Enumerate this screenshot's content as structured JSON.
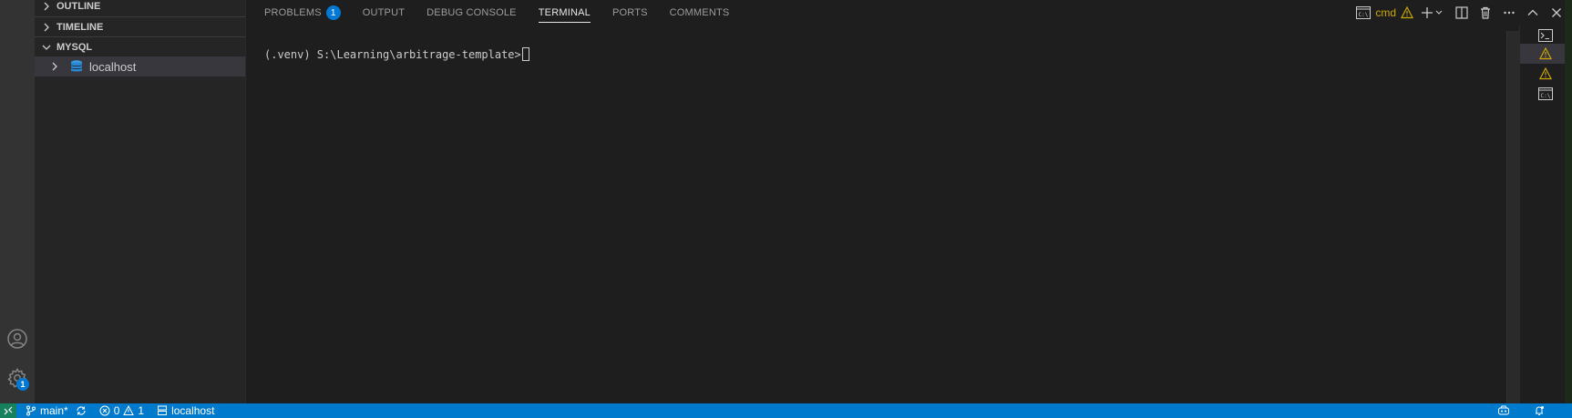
{
  "sidebar": {
    "sections": {
      "outline": "OUTLINE",
      "timeline": "TIMELINE",
      "mysql": "MYSQL"
    },
    "tree": {
      "connection": "localhost"
    }
  },
  "activity_bar": {
    "settings_badge": "1"
  },
  "panel": {
    "tabs": {
      "problems": "PROBLEMS",
      "problems_count": "1",
      "output": "OUTPUT",
      "debug_console": "DEBUG CONSOLE",
      "terminal": "TERMINAL",
      "ports": "PORTS",
      "comments": "COMMENTS"
    },
    "active_tab": "TERMINAL",
    "terminal_name": "cmd",
    "terminal_prompt": "(.venv) S:\\Learning\\arbitrage-template>"
  },
  "status_bar": {
    "branch": "main*",
    "errors": "0",
    "warnings": "1",
    "connection": "localhost"
  },
  "colors": {
    "accent": "#007acc",
    "badge": "#0078d4",
    "warning": "#cca700",
    "remote": "#16825d"
  }
}
